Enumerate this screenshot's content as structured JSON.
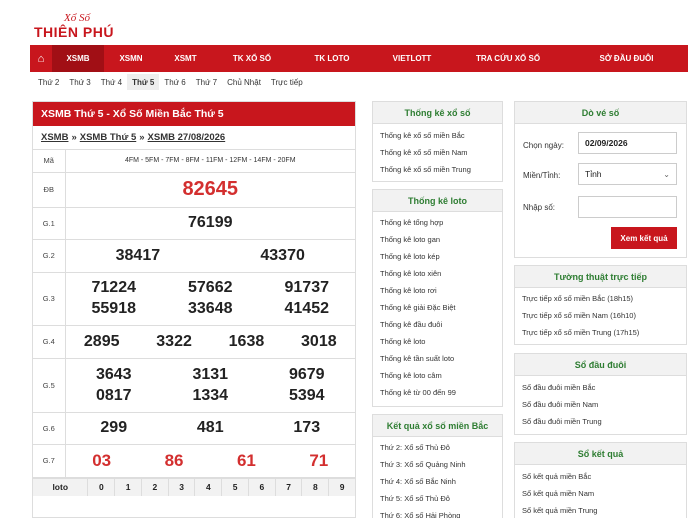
{
  "logo": {
    "script": "Xổ Số",
    "brand": "THIÊN PHÚ"
  },
  "nav": {
    "items": [
      "XSMB",
      "XSMN",
      "XSMT",
      "TK XỔ SỐ",
      "TK LOTO",
      "VIETLOTT",
      "TRA CỨU XỔ SỐ",
      "SỞ ĐẦU ĐUÔI"
    ]
  },
  "subnav": [
    "Thứ 2",
    "Thứ 3",
    "Thứ 4",
    "Thứ 5",
    "Thứ 6",
    "Thứ 7",
    "Chủ Nhật",
    "Trực tiếp"
  ],
  "results": {
    "title": "XSMB Thứ 5 - Xổ Số Miền Bắc Thứ 5",
    "crumbs": [
      "XSMB",
      "XSMB Thứ 5",
      "XSMB 27/08/2026"
    ],
    "ma_label": "Mã",
    "ma_value": "4FM - 5FM - 7FM - 8FM - 11FM - 12FM - 14FM - 20FM",
    "labels": {
      "db": "ĐB",
      "g1": "G.1",
      "g2": "G.2",
      "g3": "G.3",
      "g4": "G.4",
      "g5": "G.5",
      "g6": "G.6",
      "g7": "G.7"
    },
    "db": "82645",
    "g1": "76199",
    "g2": [
      "38417",
      "43370"
    ],
    "g3": [
      "71224",
      "57662",
      "91737",
      "55918",
      "33648",
      "41452"
    ],
    "g4": [
      "2895",
      "3322",
      "1638",
      "3018"
    ],
    "g5": [
      "3643",
      "3131",
      "9679",
      "0817",
      "1334",
      "5394"
    ],
    "g6": [
      "299",
      "481",
      "173"
    ],
    "g7": [
      "03",
      "86",
      "61",
      "71"
    ],
    "loto_label": "loto",
    "loto_digits": [
      "0",
      "1",
      "2",
      "3",
      "4",
      "5",
      "6",
      "7",
      "8",
      "9"
    ]
  },
  "thongke": {
    "title": "Thống kê xổ số",
    "items": [
      "Thống kê xổ số miền Bắc",
      "Thống kê xổ số miền Nam",
      "Thống kê xổ số miền Trung"
    ]
  },
  "thongke_loto": {
    "title": "Thống kê loto",
    "items": [
      "Thống kê tổng hợp",
      "Thống kê loto gan",
      "Thống kê loto kép",
      "Thống kê loto xiên",
      "Thống kê loto rơi",
      "Thống kê giải Đặc Biệt",
      "Thống kê đầu đuôi",
      "Thống kê loto",
      "Thống kê tần suất loto",
      "Thống kê loto câm",
      "Thống kê từ 00 đến 99"
    ]
  },
  "kq_mb": {
    "title": "Kết quả xổ số miền Bắc",
    "items": [
      "Thứ 2: Xổ số Thủ Đô",
      "Thứ 3: Xổ số Quảng Ninh",
      "Thứ 4: Xổ số Bắc Ninh",
      "Thứ 5: Xổ số Thủ Đô",
      "Thứ 6: Xổ số Hải Phòng"
    ]
  },
  "dove": {
    "title": "Dò vé số",
    "date_label": "Chọn ngày:",
    "date_value": "02/09/2026",
    "region_label": "Miền/Tỉnh:",
    "region_value": "Tỉnh",
    "number_label": "Nhập số:",
    "number_value": "",
    "submit": "Xem kết quả"
  },
  "tuongthuat": {
    "title": "Tường thuật trực tiếp",
    "items": [
      "Trực tiếp xổ số miền Bắc (18h15)",
      "Trực tiếp xổ số miền Nam (16h10)",
      "Trực tiếp xổ số miền Trung (17h15)"
    ]
  },
  "sodauduoi": {
    "title": "Sổ đầu đuôi",
    "items": [
      "Sổ đầu đuôi miền Bắc",
      "Sổ đầu đuôi miền Nam",
      "Sổ đầu đuôi miền Trung"
    ]
  },
  "soketqua": {
    "title": "Sổ kết quả",
    "items": [
      "Sổ kết quả miền Bắc",
      "Sổ kết quả miền Nam",
      "Sổ kết quả miền Trung"
    ]
  }
}
